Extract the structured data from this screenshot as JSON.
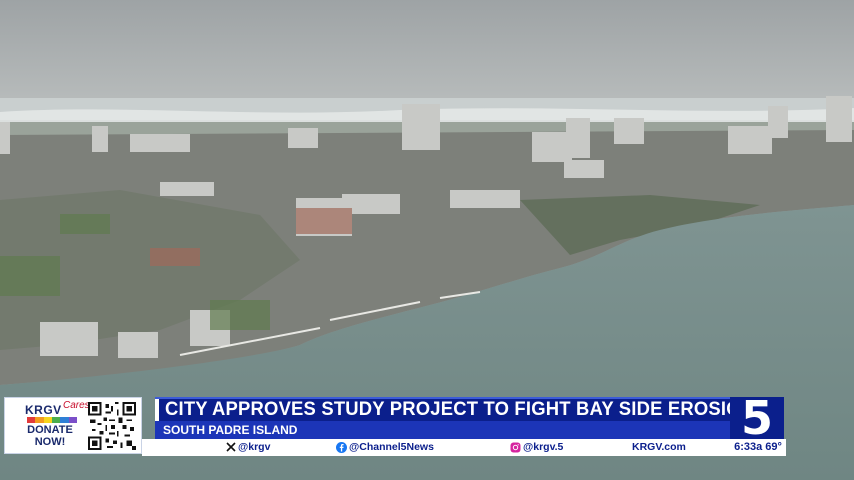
{
  "scene": {
    "description_icon": "aerial-photo"
  },
  "donate": {
    "brand": "KRGV",
    "brand_suffix": "Cares",
    "label_line1": "DONATE",
    "label_line2": "NOW!",
    "qr_icon": "qr-code-icon"
  },
  "headline": "CITY APPROVES STUDY PROJECT TO FIGHT BAY SIDE EROSION",
  "subheadline": "SOUTH PADRE ISLAND",
  "social": {
    "x_handle": "@krgv",
    "facebook_handle": "@Channel5News",
    "instagram_handle": "@krgv.5",
    "website": "KRGV.com"
  },
  "channel_number": "5",
  "time_temp": "6:33a 69°",
  "colors": {
    "navy": "#0b1f8c",
    "blue": "#1c35b8",
    "white": "#ffffff",
    "bay": "#8a9898"
  }
}
